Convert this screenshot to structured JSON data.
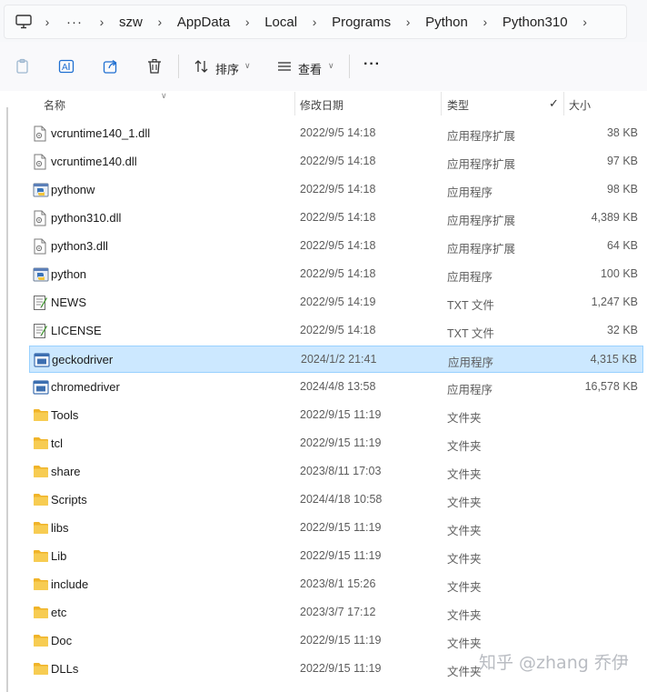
{
  "breadcrumb": {
    "more": "···",
    "items": [
      "szw",
      "AppData",
      "Local",
      "Programs",
      "Python",
      "Python310"
    ]
  },
  "toolbar": {
    "sort_label": "排序",
    "view_label": "查看",
    "more_label": "···"
  },
  "columns": {
    "name": "名称",
    "date": "修改日期",
    "type": "类型",
    "size": "大小"
  },
  "files": [
    {
      "name": "vcruntime140_1.dll",
      "date": "2022/9/5 14:18",
      "type": "应用程序扩展",
      "size": "38 KB",
      "icon": "dll-file-icon"
    },
    {
      "name": "vcruntime140.dll",
      "date": "2022/9/5 14:18",
      "type": "应用程序扩展",
      "size": "97 KB",
      "icon": "dll-file-icon"
    },
    {
      "name": "pythonw",
      "date": "2022/9/5 14:18",
      "type": "应用程序",
      "size": "98 KB",
      "icon": "python-app-icon"
    },
    {
      "name": "python310.dll",
      "date": "2022/9/5 14:18",
      "type": "应用程序扩展",
      "size": "4,389 KB",
      "icon": "dll-file-icon"
    },
    {
      "name": "python3.dll",
      "date": "2022/9/5 14:18",
      "type": "应用程序扩展",
      "size": "64 KB",
      "icon": "dll-file-icon"
    },
    {
      "name": "python",
      "date": "2022/9/5 14:18",
      "type": "应用程序",
      "size": "100 KB",
      "icon": "python-app-icon"
    },
    {
      "name": "NEWS",
      "date": "2022/9/5 14:19",
      "type": "TXT 文件",
      "size": "1,247 KB",
      "icon": "text-file-icon"
    },
    {
      "name": "LICENSE",
      "date": "2022/9/5 14:18",
      "type": "TXT 文件",
      "size": "32 KB",
      "icon": "text-file-icon"
    },
    {
      "name": "geckodriver",
      "date": "2024/1/2 21:41",
      "type": "应用程序",
      "size": "4,315 KB",
      "icon": "exe-app-icon",
      "selected": true
    },
    {
      "name": "chromedriver",
      "date": "2024/4/8 13:58",
      "type": "应用程序",
      "size": "16,578 KB",
      "icon": "exe-app-icon"
    },
    {
      "name": "Tools",
      "date": "2022/9/15 11:19",
      "type": "文件夹",
      "size": "",
      "icon": "folder-icon"
    },
    {
      "name": "tcl",
      "date": "2022/9/15 11:19",
      "type": "文件夹",
      "size": "",
      "icon": "folder-icon"
    },
    {
      "name": "share",
      "date": "2023/8/11 17:03",
      "type": "文件夹",
      "size": "",
      "icon": "folder-icon"
    },
    {
      "name": "Scripts",
      "date": "2024/4/18 10:58",
      "type": "文件夹",
      "size": "",
      "icon": "folder-icon"
    },
    {
      "name": "libs",
      "date": "2022/9/15 11:19",
      "type": "文件夹",
      "size": "",
      "icon": "folder-icon"
    },
    {
      "name": "Lib",
      "date": "2022/9/15 11:19",
      "type": "文件夹",
      "size": "",
      "icon": "folder-icon"
    },
    {
      "name": "include",
      "date": "2023/8/1 15:26",
      "type": "文件夹",
      "size": "",
      "icon": "folder-icon"
    },
    {
      "name": "etc",
      "date": "2023/3/7 17:12",
      "type": "文件夹",
      "size": "",
      "icon": "folder-icon"
    },
    {
      "name": "Doc",
      "date": "2022/9/15 11:19",
      "type": "文件夹",
      "size": "",
      "icon": "folder-icon"
    },
    {
      "name": "DLLs",
      "date": "2022/9/15 11:19",
      "type": "文件夹",
      "size": "",
      "icon": "folder-icon"
    }
  ],
  "watermark": "知乎 @zhang 乔伊",
  "colors": {
    "selected_bg": "#cce8ff",
    "selected_border": "#99d1ff",
    "folder": "#f3c74d",
    "accent": "#1f6fd1"
  }
}
